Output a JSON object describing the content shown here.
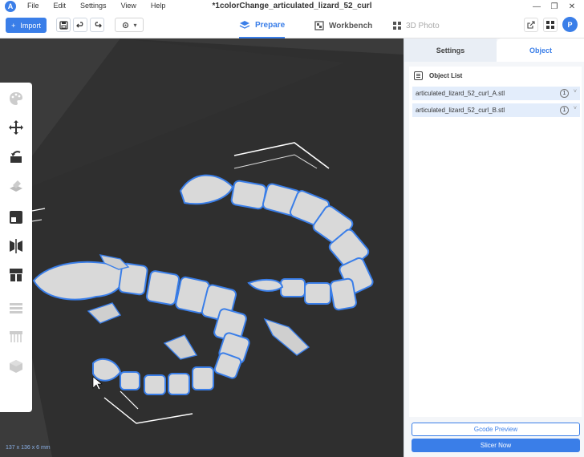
{
  "titlebar": {
    "title": "*1colorChange_articulated_lizard_52_curl",
    "menu": [
      "File",
      "Edit",
      "Settings",
      "View",
      "Help"
    ]
  },
  "toolbar": {
    "import_label": "Import",
    "tabs": [
      {
        "label": "Prepare",
        "active": true
      },
      {
        "label": "Workbench",
        "active": false
      },
      {
        "label": "3D Photo",
        "active": false
      }
    ],
    "avatar_letter": "P"
  },
  "viewport": {
    "dimensions": "137 x 136 x 6 mm"
  },
  "panel": {
    "tabs": [
      "Settings",
      "Object"
    ],
    "object_list_title": "Object List",
    "objects": [
      {
        "name": "articulated_lizard_52_curl_A.stl",
        "count": "1"
      },
      {
        "name": "articulated_lizard_52_curl_B.stl",
        "count": "1"
      }
    ],
    "gcode_preview_label": "Gcode Preview",
    "slice_now_label": "Slicer Now"
  },
  "colors": {
    "accent": "#3a7ee8",
    "bed": "#3b3b3b",
    "model": "#d8d8d8"
  }
}
